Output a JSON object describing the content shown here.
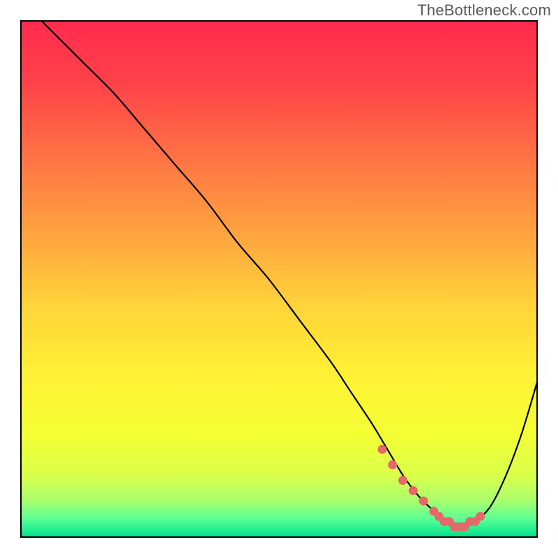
{
  "watermark": "TheBottleneck.com",
  "chart_data": {
    "type": "line",
    "title": "",
    "xlabel": "",
    "ylabel": "",
    "xlim": [
      0,
      100
    ],
    "ylim": [
      0,
      100
    ],
    "background_gradient": {
      "stops": [
        {
          "offset": 0.0,
          "color": "#ff2b4e"
        },
        {
          "offset": 0.12,
          "color": "#ff4249"
        },
        {
          "offset": 0.28,
          "color": "#ff7844"
        },
        {
          "offset": 0.42,
          "color": "#ffa63f"
        },
        {
          "offset": 0.55,
          "color": "#ffd33a"
        },
        {
          "offset": 0.68,
          "color": "#fff035"
        },
        {
          "offset": 0.8,
          "color": "#f4ff34"
        },
        {
          "offset": 0.88,
          "color": "#d9ff4a"
        },
        {
          "offset": 0.93,
          "color": "#a9ff6e"
        },
        {
          "offset": 0.965,
          "color": "#5aff96"
        },
        {
          "offset": 1.0,
          "color": "#00e08a"
        }
      ]
    },
    "series": [
      {
        "name": "bottleneck-curve",
        "color": "#000000",
        "x": [
          4,
          8,
          12,
          18,
          24,
          30,
          36,
          42,
          48,
          54,
          60,
          64,
          68,
          71,
          74,
          77,
          80,
          82,
          84,
          86,
          88,
          91,
          94,
          97,
          100
        ],
        "y": [
          100,
          96,
          92,
          86,
          79,
          72,
          65,
          57,
          50,
          42,
          34,
          28,
          22,
          17,
          12,
          8,
          5,
          3,
          2,
          2,
          3,
          6,
          12,
          20,
          30
        ]
      }
    ],
    "optimal_markers": {
      "name": "optimal-range",
      "color": "#e46a6a",
      "x": [
        70,
        72,
        74,
        76,
        78,
        80,
        81,
        82,
        83,
        84,
        85,
        86,
        87,
        88,
        89
      ],
      "y": [
        17,
        14,
        11,
        9,
        7,
        5,
        4,
        3,
        3,
        2,
        2,
        2,
        3,
        3,
        4
      ]
    }
  }
}
